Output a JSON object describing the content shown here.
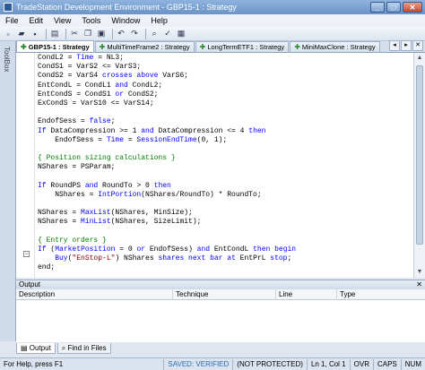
{
  "window": {
    "title": "TradeStation Development Environment - GBP15-1 : Strategy"
  },
  "menu": [
    "File",
    "Edit",
    "View",
    "Tools",
    "Window",
    "Help"
  ],
  "sidebar": {
    "label": "ToolBox"
  },
  "tabs": [
    {
      "label": "GBP15-1 : Strategy",
      "active": true
    },
    {
      "label": "MultiTimeFrame2 : Strategy",
      "active": false
    },
    {
      "label": "LongTermETF1 : Strategy",
      "active": false
    },
    {
      "label": "MiniMaxClone : Strategy",
      "active": false
    }
  ],
  "code": [
    [
      [
        "CondL2 = ",
        ""
      ],
      [
        "Time",
        "kw"
      ],
      [
        " = NL3;",
        ""
      ]
    ],
    [
      [
        "CondS1 = VarS2 <= VarS3;",
        ""
      ]
    ],
    [
      [
        "CondS2 = VarS4 ",
        ""
      ],
      [
        "crosses above",
        ""
      ],
      [
        " VarS6;",
        ""
      ]
    ],
    [
      [
        "EntCondL = CondL1 ",
        ""
      ],
      [
        "and",
        ""
      ],
      [
        " CondL2;",
        ""
      ]
    ],
    [
      [
        "EntCondS = CondS1 ",
        ""
      ],
      [
        "or",
        ""
      ],
      [
        " CondS2;",
        ""
      ]
    ],
    [
      [
        "ExCondS = VarS10 <= VarS14;",
        ""
      ]
    ],
    [
      [
        "",
        ""
      ]
    ],
    [
      [
        "EndofSess = ",
        ""
      ],
      [
        "false",
        ""
      ],
      [
        ";",
        ""
      ]
    ],
    [
      [
        "If",
        ""
      ],
      [
        " DataCompression >= 1 ",
        ""
      ],
      [
        "and",
        ""
      ],
      [
        " DataCompression <= 4 ",
        ""
      ],
      [
        "then",
        ""
      ]
    ],
    [
      [
        "    EndofSess = ",
        ""
      ],
      [
        "Time",
        ""
      ],
      [
        " = ",
        ""
      ],
      [
        "SessionEndTime",
        ""
      ],
      [
        "(0, 1);",
        ""
      ]
    ],
    [
      [
        "",
        ""
      ]
    ],
    [
      [
        "{ Position sizing calculations }",
        "cm"
      ]
    ],
    [
      [
        "NShares = PSParam;",
        ""
      ]
    ],
    [
      [
        "",
        ""
      ]
    ],
    [
      [
        "If",
        ""
      ],
      [
        " RoundPS ",
        ""
      ],
      [
        "and",
        ""
      ],
      [
        " RoundTo > 0 ",
        ""
      ],
      [
        "then",
        ""
      ]
    ],
    [
      [
        "    NShares = ",
        ""
      ],
      [
        "IntPortion",
        ""
      ],
      [
        "(NShares/RoundTo) * RoundTo;",
        ""
      ]
    ],
    [
      [
        "",
        ""
      ]
    ],
    [
      [
        "NShares = ",
        ""
      ],
      [
        "MaxList",
        ""
      ],
      [
        "(NShares, MinSize);",
        ""
      ]
    ],
    [
      [
        "NShares = ",
        ""
      ],
      [
        "MinList",
        ""
      ],
      [
        "(NShares, SizeLimit);",
        ""
      ]
    ],
    [
      [
        "",
        ""
      ]
    ],
    [
      [
        "{ Entry orders }",
        "cm"
      ]
    ],
    [
      [
        "If",
        ""
      ],
      [
        " (",
        ""
      ],
      [
        "MarketPosition",
        ""
      ],
      [
        " = 0 ",
        ""
      ],
      [
        "or",
        ""
      ],
      [
        " EndofSess) ",
        ""
      ],
      [
        "and",
        ""
      ],
      [
        " EntCondL ",
        ""
      ],
      [
        "then begin",
        ""
      ]
    ],
    [
      [
        "    ",
        ""
      ],
      [
        "Buy",
        ""
      ],
      [
        "(",
        ""
      ],
      [
        "\"EnStop-L\"",
        "st"
      ],
      [
        ") NShares ",
        ""
      ],
      [
        "shares next bar at",
        ""
      ],
      [
        " EntPrL ",
        ""
      ],
      [
        "stop",
        ""
      ],
      [
        ";",
        ""
      ]
    ],
    [
      [
        "end;",
        ""
      ]
    ]
  ],
  "output": {
    "title": "Output",
    "columns": [
      "Description",
      "Technique",
      "Line",
      "Type"
    ],
    "tabs": [
      "Output",
      "Find in Files"
    ]
  },
  "status": {
    "help": "For Help, press F1",
    "saved": "SAVED: VERIFIED",
    "protect": "(NOT PROTECTED)",
    "position": "Ln 1, Col 1",
    "ovr": "OVR",
    "caps": "CAPS",
    "num": "NUM"
  },
  "colors": {
    "keyword": "#0000ff",
    "comment": "#008000",
    "string": "#800000"
  }
}
